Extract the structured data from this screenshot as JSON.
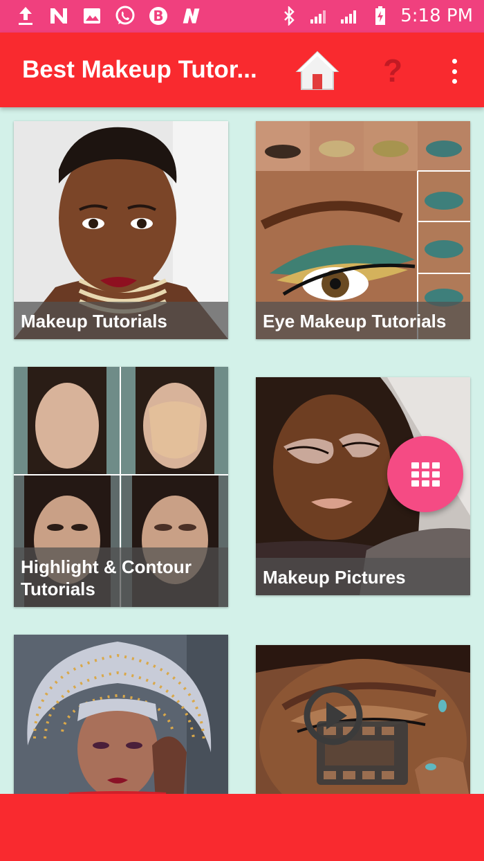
{
  "status_bar": {
    "time": "5:18 PM",
    "icons": [
      "upload-icon",
      "n-icon",
      "image-icon",
      "whatsapp-icon",
      "b-icon",
      "n-bold-icon",
      "bluetooth-icon",
      "signal-icon",
      "signal-icon",
      "battery-charging-icon"
    ]
  },
  "app_bar": {
    "title": "Best Makeup Tutor...",
    "home_icon": "home-icon",
    "help_icon": "question-mark-icon",
    "help_glyph": "?",
    "more_icon": "more-vert-icon"
  },
  "cards": [
    {
      "label": "Makeup Tutorials",
      "image": "woman-portrait"
    },
    {
      "label": "Eye Makeup Tutorials",
      "image": "eye-makeup-steps"
    },
    {
      "label": "Highlight & Contour\nTutorials",
      "image": "contour-collage"
    },
    {
      "label": "Makeup Pictures",
      "image": "glam-eye-makeup"
    },
    {
      "label": "",
      "image": "gele-headwrap-portrait"
    },
    {
      "label": "",
      "image": "video-tutorial-portrait"
    }
  ],
  "fab": {
    "icon": "apps-grid-icon"
  },
  "colors": {
    "status_bar": "#f0407e",
    "app_bar": "#f92a2f",
    "background": "#d3f1e9",
    "fab": "#f54b84",
    "help_icon": "#c21a24"
  }
}
